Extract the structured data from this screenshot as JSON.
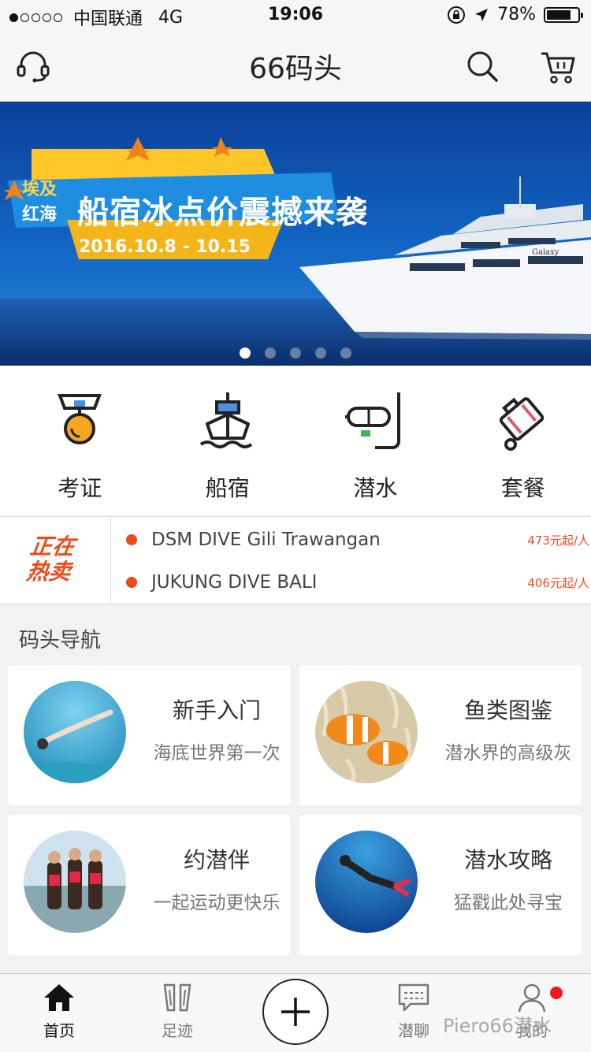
{
  "status": {
    "carrier": "中国联通",
    "network": "4G",
    "time": "19:06",
    "battery": "78%",
    "battery_level": 0.78
  },
  "header": {
    "title": "66码头"
  },
  "banner": {
    "tag_line1": "埃及",
    "tag_line2": "红海",
    "headline": "船宿冰点价震撼来袭",
    "dates": "2016.10.8 - 10.15",
    "ship_name": "Galaxy",
    "page_count": 5,
    "active_page": 1
  },
  "categories": [
    {
      "label": "考证",
      "icon": "medal-icon"
    },
    {
      "label": "船宿",
      "icon": "ship-icon"
    },
    {
      "label": "潜水",
      "icon": "snorkel-mask-icon"
    },
    {
      "label": "套餐",
      "icon": "luggage-icon"
    }
  ],
  "hot_sale": {
    "badge_line1": "正在",
    "badge_line2": "热卖",
    "items": [
      {
        "name": "DSM DIVE Gili Trawangan",
        "price": "473元起/人"
      },
      {
        "name": "JUKUNG DIVE BALI",
        "price": "406元起/人"
      }
    ]
  },
  "guide": {
    "title": "码头导航",
    "cards": [
      {
        "title": "新手入门",
        "subtitle": "海底世界第一次"
      },
      {
        "title": "鱼类图鉴",
        "subtitle": "潜水界的高级灰"
      },
      {
        "title": "约潜伴",
        "subtitle": "一起运动更快乐"
      },
      {
        "title": "潜水攻略",
        "subtitle": "猛戳此处寻宝"
      }
    ]
  },
  "tabbar": {
    "home": "首页",
    "footprint": "足迹",
    "chat": "潜聊",
    "mine": "我的"
  },
  "watermark": "Piero66潜水",
  "colors": {
    "accent": "#f04a1a",
    "icon_dark": "#222222",
    "icon_orange": "#f5a623",
    "icon_blue": "#4a90e2",
    "icon_green": "#4caf50"
  }
}
